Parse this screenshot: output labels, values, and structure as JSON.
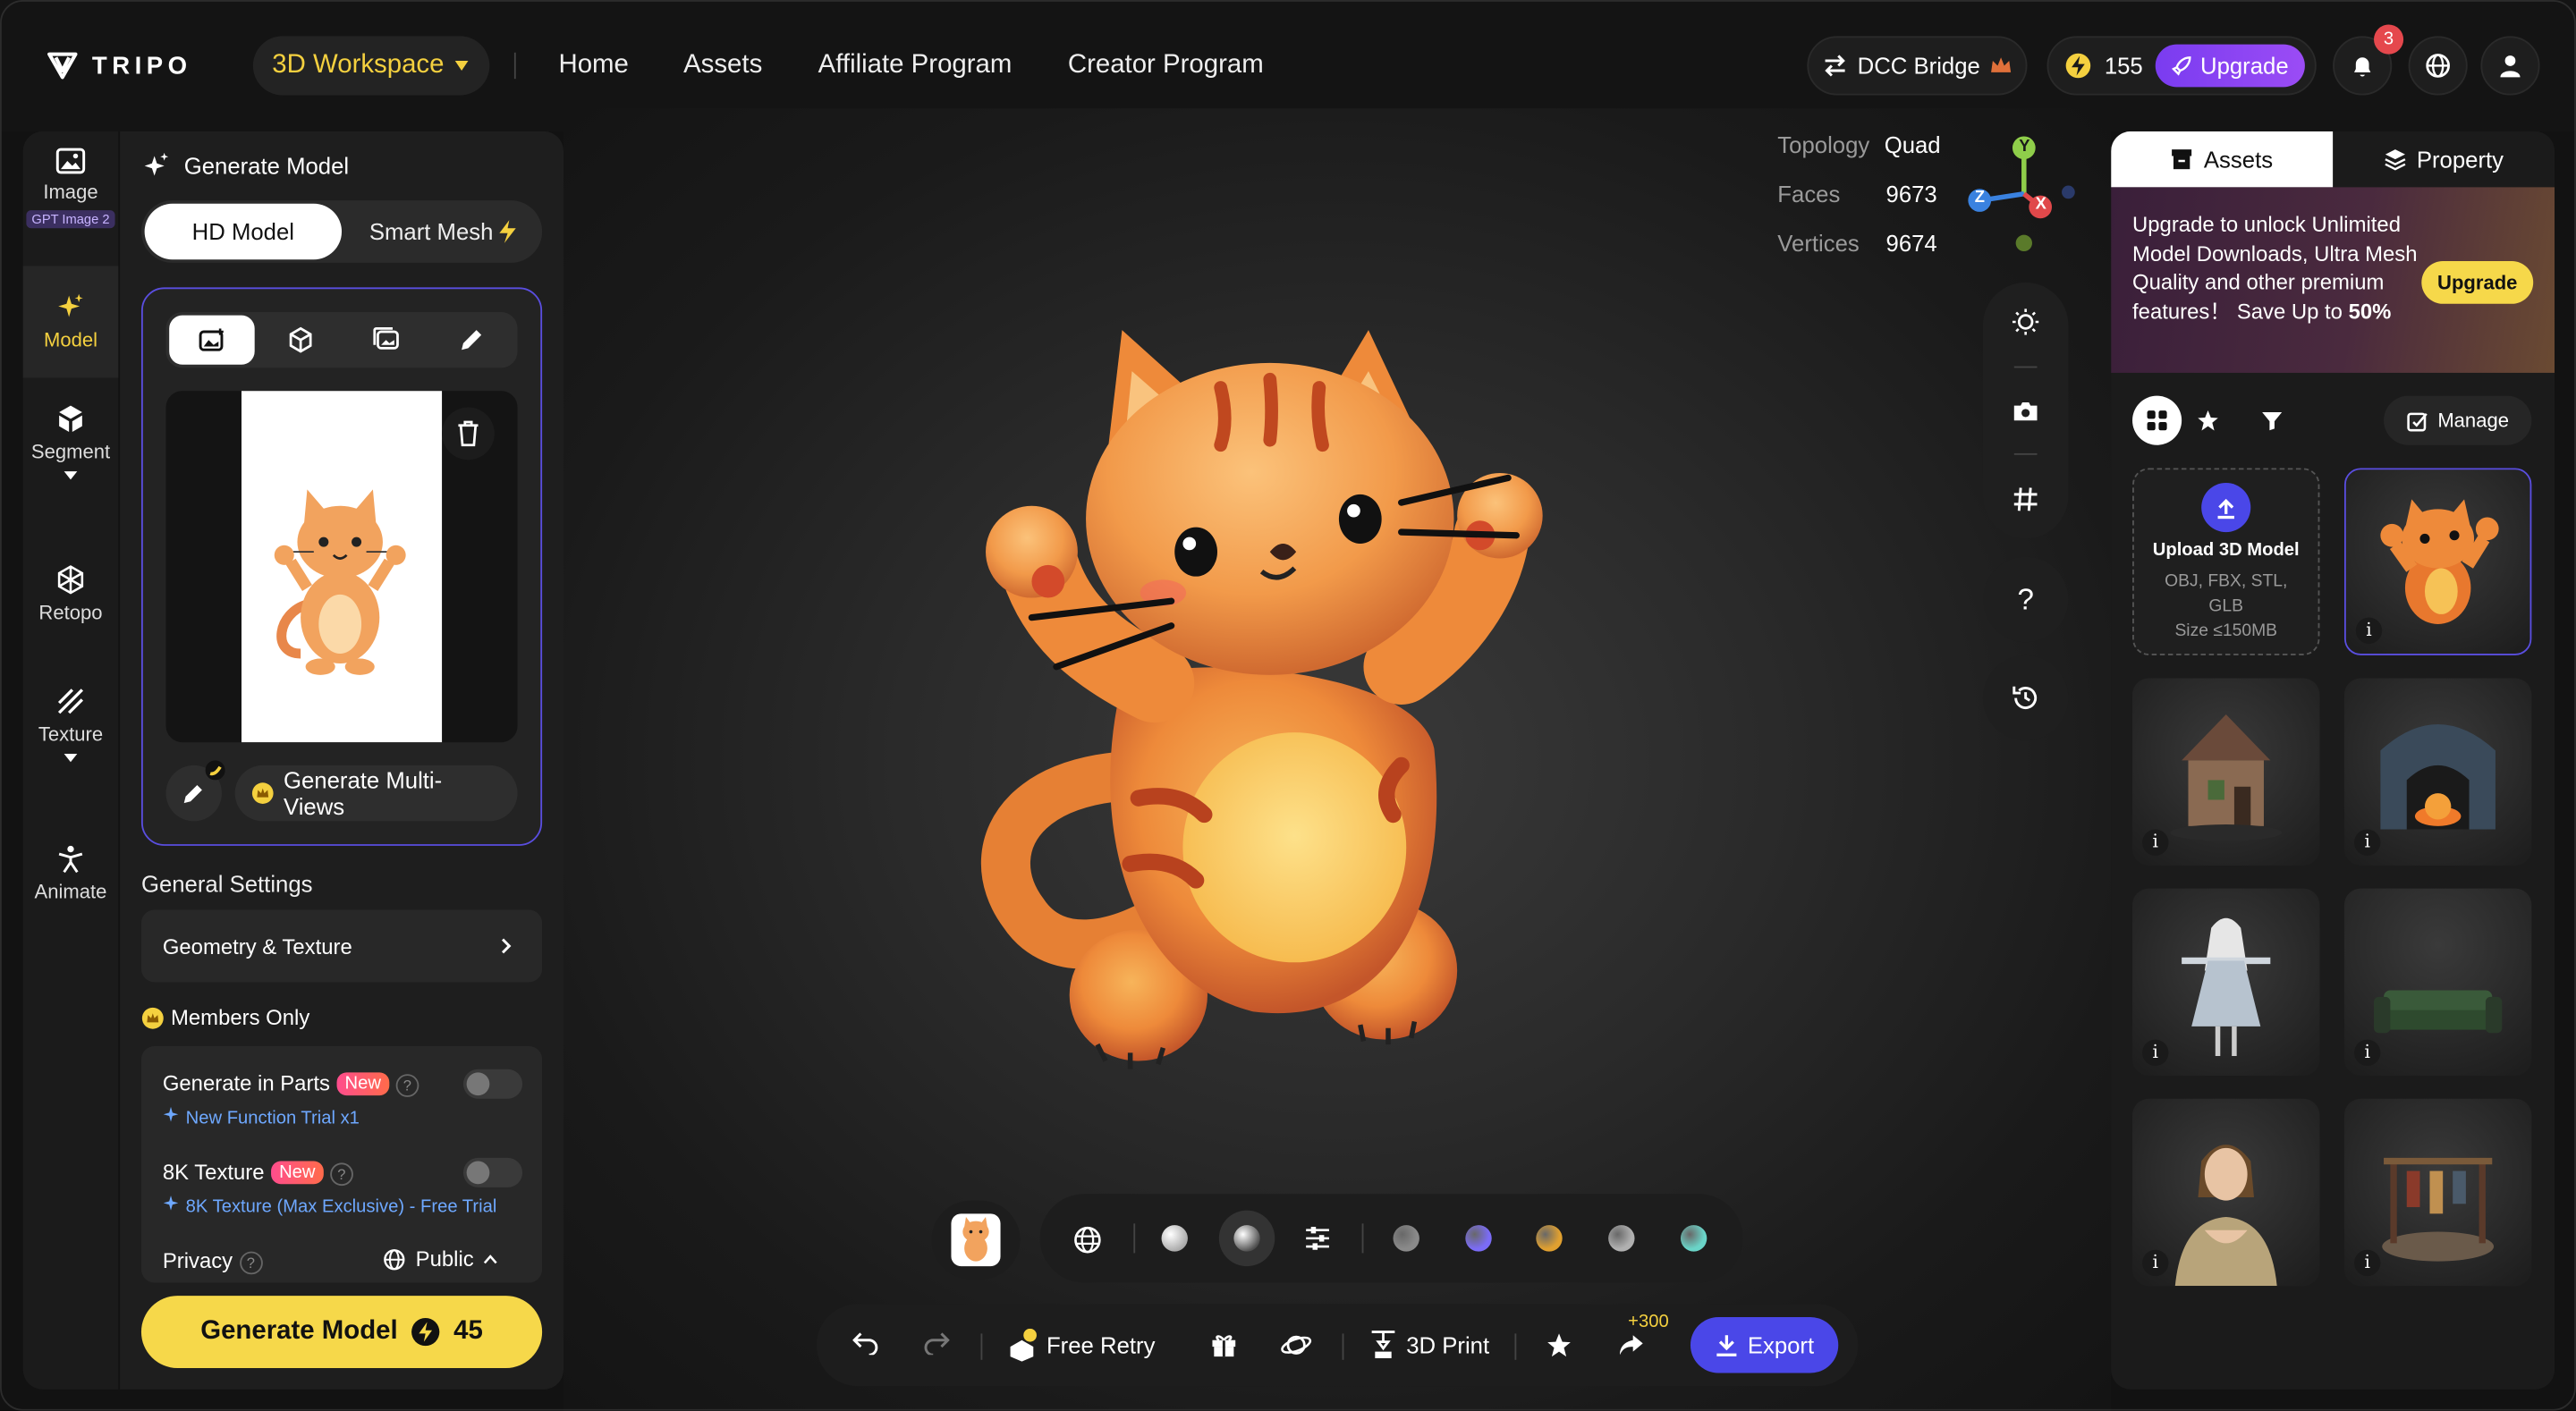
{
  "header": {
    "logo_text": "TRIPO",
    "workspace_label": "3D Workspace",
    "nav": [
      "Home",
      "Assets",
      "Affiliate Program",
      "Creator Program"
    ],
    "dcc_label": "DCC Bridge",
    "credits": "155",
    "upgrade_label": "Upgrade",
    "notifications_count": "3",
    "accent": "#f4d03f"
  },
  "rail": {
    "items": [
      {
        "label": "Image",
        "badge": "GPT Image 2",
        "icon": "image-icon"
      },
      {
        "label": "Model",
        "icon": "sparkle-icon"
      },
      {
        "label": "Segment",
        "icon": "cube-split-icon"
      },
      {
        "label": "Retopo",
        "icon": "mesh-icon"
      },
      {
        "label": "Texture",
        "icon": "texture-icon"
      },
      {
        "label": "Animate",
        "icon": "figure-icon"
      }
    ]
  },
  "panel": {
    "title": "Generate Model",
    "mode_hd": "HD Model",
    "mode_smart": "Smart Mesh",
    "generate_multiviews": "Generate Multi-Views",
    "general_settings": "General Settings",
    "geometry_texture": "Geometry & Texture",
    "members_only": "Members Only",
    "generate_in_parts": "Generate in Parts",
    "new_badge": "New",
    "parts_sub": "New Function Trial x1",
    "texture_8k": "8K Texture",
    "texture_8k_sub": "8K Texture (Max Exclusive) - Free Trial",
    "privacy": "Privacy",
    "privacy_value": "Public",
    "generate_btn": "Generate Model",
    "generate_cost": "45"
  },
  "viewport": {
    "stats": [
      {
        "label": "Topology",
        "value": "Quad"
      },
      {
        "label": "Faces",
        "value": "9673"
      },
      {
        "label": "Vertices",
        "value": "9674"
      }
    ],
    "axes": {
      "y": "Y",
      "z": "Z",
      "x": "X"
    },
    "help": "?",
    "bottom": {
      "free_retry": "Free Retry",
      "print3d": "3D Print",
      "share_bonus": "+300",
      "export": "Export"
    },
    "material_colors": [
      "#8a8a8a",
      "#7b6cf6",
      "#e0a030",
      "#b0b0b0",
      "#6ad4c8"
    ]
  },
  "right": {
    "tab_assets": "Assets",
    "tab_property": "Property",
    "promo_line": "Upgrade to unlock Unlimited Model Downloads, Ultra Mesh Quality and other premium features！ Save Up to",
    "promo_pct": "50%",
    "promo_btn": "Upgrade",
    "manage": "Manage",
    "upload_title": "Upload 3D Model",
    "upload_formats": "OBJ, FBX, STL, GLB",
    "upload_size": "Size ≤150MB",
    "info": "i"
  }
}
